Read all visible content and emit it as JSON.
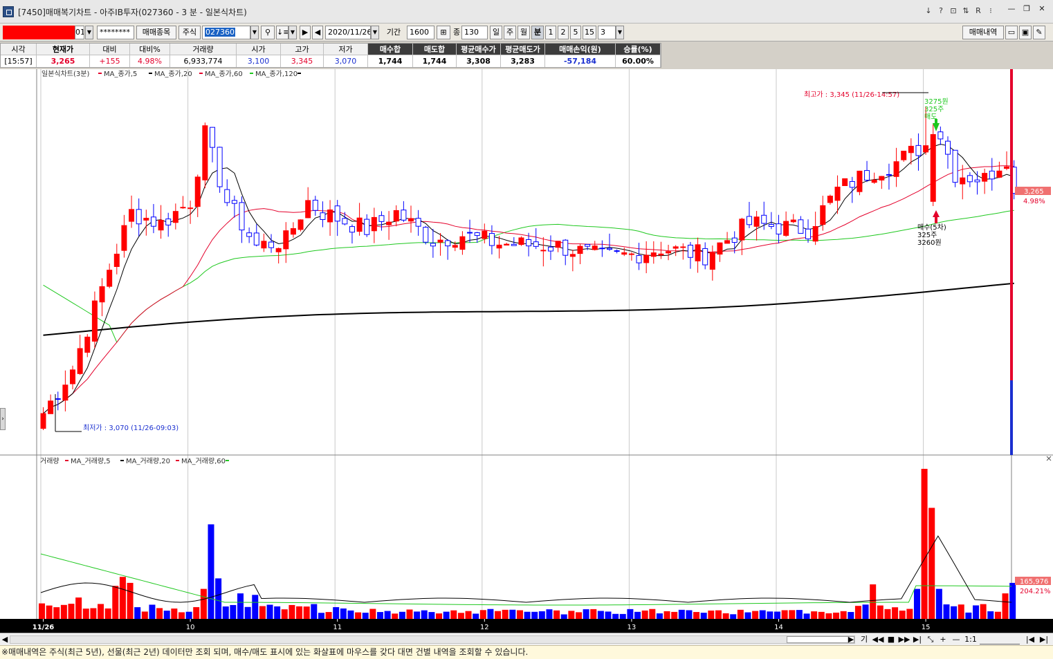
{
  "window": {
    "title": "[7450]매매복기차트 - 아주IB투자(027360 - 3 분 - 일본식차트)",
    "tool_icons": [
      "↓",
      "?",
      "⊡",
      "⇅",
      "R",
      "⁝"
    ],
    "minimize": "—",
    "restore": "❐",
    "close": "✕"
  },
  "toolbar": {
    "account_suffix": "01",
    "password_mask": "********",
    "trade_item_button": "매매종목",
    "market_label": "주식",
    "code_value": "027360",
    "date_value": "2020/11/26",
    "period_label": "기간",
    "period_value": "1600",
    "count_label": "종",
    "count_value": "130",
    "day_tab": "일",
    "week_tab": "주",
    "month_tab": "월",
    "minute_tab": "분",
    "intervals": [
      "1",
      "2",
      "5",
      "15"
    ],
    "interval_select": "3",
    "trade_history_button": "매매내역"
  },
  "quote": {
    "headers": [
      "시각",
      "현재가",
      "대비",
      "대비%",
      "거래량",
      "시가",
      "고가",
      "저가",
      "매수합",
      "매도합",
      "평균매수가",
      "평균매도가",
      "매매손익(원)",
      "승률(%)"
    ],
    "values": [
      "[15:57]",
      "3,265",
      "+155",
      "4.98%",
      "6,933,774",
      "3,100",
      "3,345",
      "3,070",
      "1,744",
      "1,744",
      "3,308",
      "3,283",
      "-57,184",
      "60.00%"
    ]
  },
  "chart": {
    "price_legend": "일본식차트(3분)",
    "volume_legend": "거래량",
    "ma_price_labels": [
      "MA_종가,5",
      "MA_종가,20",
      "MA_종가,60",
      "MA_종가,120"
    ],
    "ma_volume_labels": [
      "MA_거래량,5",
      "MA_거래량,20",
      "MA_거래량,60"
    ],
    "high_annotation": "최고가 : 3,345 (11/26-14:57)",
    "low_annotation": "최저가 : 3,070 (11/26-09:03)",
    "sell_marker": [
      "3275원",
      "325주",
      "매도"
    ],
    "buy_marker": [
      "매수(5차)",
      "325주",
      "3260원"
    ],
    "price_tag": "3,265",
    "price_pct": "4.98%",
    "volume_tag": "165,976",
    "volume_pct": "204.21%",
    "x_labels": [
      {
        "i": 0,
        "text": "11/26"
      },
      {
        "i": 20,
        "text": "10"
      },
      {
        "i": 40,
        "text": "11"
      },
      {
        "i": 60,
        "text": "12"
      },
      {
        "i": 80,
        "text": "13"
      },
      {
        "i": 100,
        "text": "14"
      },
      {
        "i": 120,
        "text": "15"
      }
    ],
    "colors": {
      "up": "#ff0000",
      "down": "#0000ff",
      "ma5": "#000000",
      "ma20": "#e4002b",
      "ma60": "#1ec81e",
      "ma120": "#000000"
    }
  },
  "scroll_controls": [
    "기",
    "◀◀",
    "■",
    "▶▶",
    "▶|",
    "⤡",
    "+",
    "—",
    "1:1",
    "|◀",
    "▶|"
  ],
  "status_text": "※매매내역은 주식(최근 5년), 선물(최근 2년) 데이터만 조회 되며, 매수/매도 표시에 있는 화살표에 마우스를 갖다 대면 건별 내역을 조회할 수 있습니다."
}
